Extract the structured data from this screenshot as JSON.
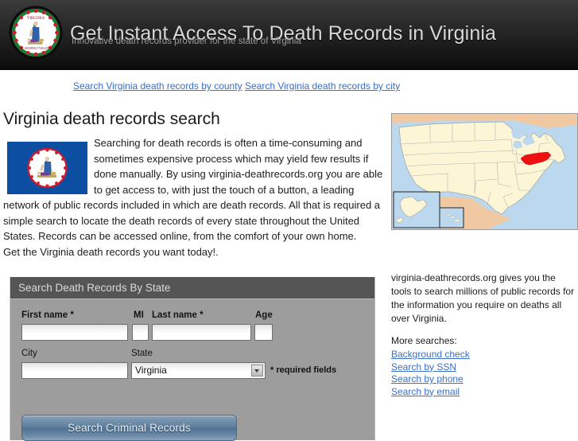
{
  "header": {
    "title": "Get Instant Access To Death Records in Virginia",
    "subtitle": "Innovative death records provider for the state of Virginia",
    "seal_icon": "virginia-state-seal-icon"
  },
  "nav": {
    "county_link": "Search Virginia death records by county",
    "city_link": "Search Virginia death records by city"
  },
  "main": {
    "page_title": "Virginia death records search",
    "flag_icon": "virginia-state-flag-icon",
    "intro_paragraph": "Searching for death records is often a time-consuming and sometimes expensive process which may yield few results if done manually. By using virginia-deathrecords.org you are able to get access to, with just the touch of a button, a leading network of public records included in which are death records. All that is required a simple search to locate the death records of every state throughout the United States. Records can be accessed online, from the comfort of your own home.",
    "intro_closing": "Get the Virginia death records you want today!.",
    "map_alt": "us-map-virginia-highlighted"
  },
  "form": {
    "panel_title": "Search Death Records By State",
    "first_name_label": "First name *",
    "first_name_value": "",
    "mi_label": "MI",
    "mi_value": "",
    "last_name_label": "Last name *",
    "last_name_value": "",
    "age_label": "Age",
    "age_value": "",
    "city_label": "City",
    "city_value": "",
    "state_label": "State",
    "state_value": "Virginia",
    "required_note": "* required fields",
    "submit_label": "Search Criminal Records"
  },
  "sidebar": {
    "description": "virginia-deathrecords.org gives you the tools to search millions of public records for the information you require on deaths all over Virginia.",
    "more_label": "More searches:",
    "links": [
      "Background check",
      "Search by SSN",
      "Search by phone",
      "Search by email"
    ]
  },
  "colors": {
    "header_dark": "#1d1d1d",
    "link_blue": "#3b6ec4",
    "panel_gray": "#9d9d9d",
    "panel_header_gray": "#555555",
    "flag_blue": "#0b4ea2",
    "highlight_red": "#ee1111",
    "map_water": "#bcd8ef",
    "map_land": "#fcf6d6"
  }
}
